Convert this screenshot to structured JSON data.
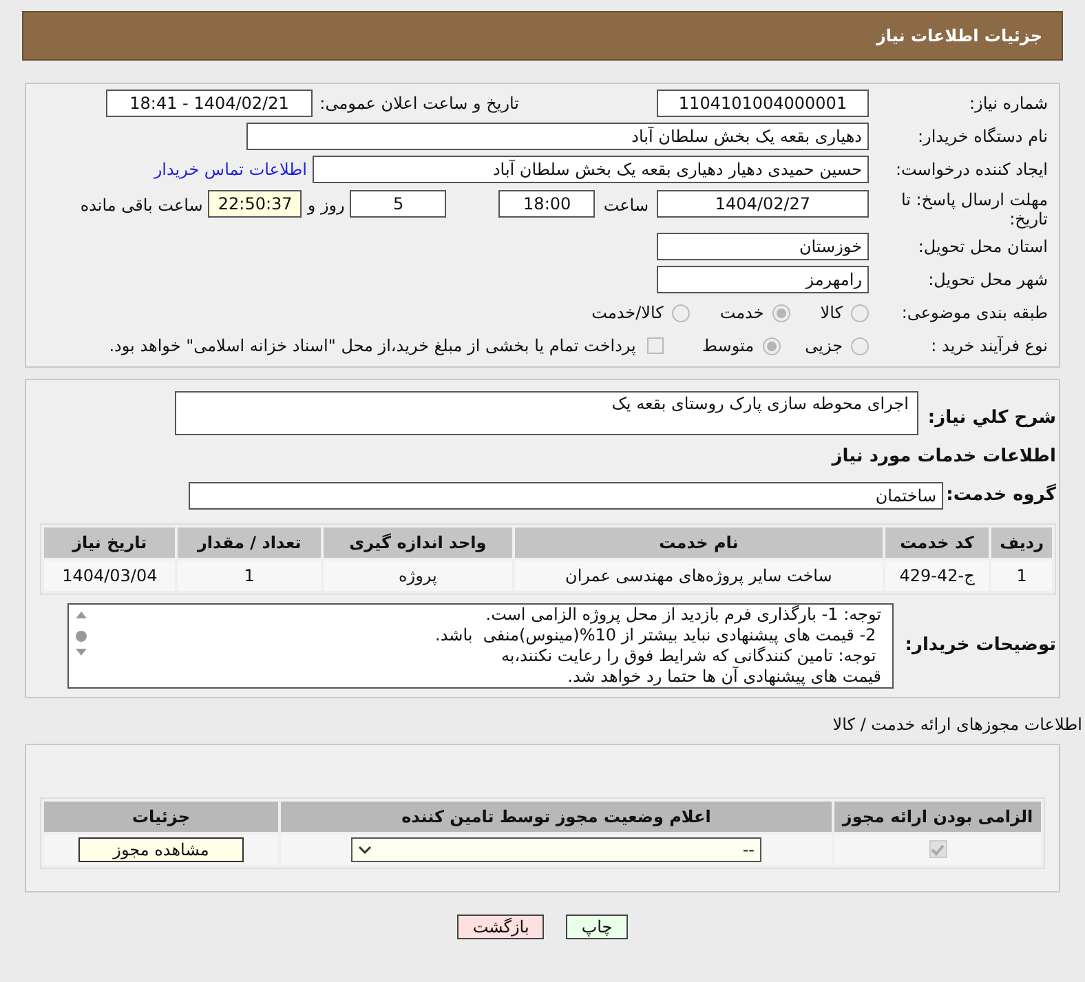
{
  "header": {
    "title": "جزئیات اطلاعات نیاز"
  },
  "need_number": {
    "label": "شماره نیاز:",
    "value": "1104101004000001"
  },
  "announce": {
    "label": "تاریخ و ساعت اعلان عمومی:",
    "value": "1404/02/21 - 18:41"
  },
  "buyer": {
    "label": "نام دستگاه خریدار:",
    "value": "دهیاری بقعه یک بخش سلطان آباد"
  },
  "requester": {
    "label": "ایجاد کننده درخواست:",
    "value": "حسین حمیدی دهیار دهیاری بقعه یک بخش سلطان آباد",
    "link": "اطلاعات تماس خریدار"
  },
  "deadline": {
    "label": "مهلت ارسال پاسخ: تا تاریخ:",
    "date": "1404/02/27",
    "time_label": "ساعت",
    "time": "18:00",
    "days": "5",
    "days_label": "روز و",
    "remaining": "22:50:37",
    "remaining_label": "ساعت باقی مانده"
  },
  "province": {
    "label": "استان محل تحویل:",
    "value": "خوزستان"
  },
  "city": {
    "label": "شهر محل تحویل:",
    "value": "رامهرمز"
  },
  "category": {
    "label": "طبقه بندی موضوعی:",
    "options": [
      {
        "label": "کالا",
        "selected": false
      },
      {
        "label": "خدمت",
        "selected": true
      },
      {
        "label": "کالا/خدمت",
        "selected": false
      }
    ]
  },
  "purchase_type": {
    "label": "نوع فرآیند خرید :",
    "options": [
      {
        "label": "جزیی",
        "selected": false
      },
      {
        "label": "متوسط",
        "selected": true
      }
    ],
    "payment": {
      "checked": false,
      "label": "پرداخت تمام یا بخشی از مبلغ خرید،از محل \"اسناد خزانه اسلامی\" خواهد بود."
    }
  },
  "description": {
    "label": "شرح کلي نیاز:",
    "value": "اجرای محوطه سازی پارک روستای بقعه یک"
  },
  "services_heading": "اطلاعات خدمات مورد نیاز",
  "service_group": {
    "label": "گروه خدمت:",
    "value": "ساختمان"
  },
  "services_table": {
    "columns": [
      "ردیف",
      "کد خدمت",
      "نام خدمت",
      "واحد اندازه گیری",
      "تعداد / مقدار",
      "تاریخ نیاز"
    ],
    "rows": [
      [
        "1",
        "ج-42-429",
        "ساخت سایر پروژه‌های مهندسی عمران",
        "پروژه",
        "1",
        "1404/03/04"
      ]
    ]
  },
  "buyer_notes": {
    "label": "توضیحات خریدار:",
    "lines": [
      "توجه: 1- بارگذاری فرم بازدید از محل پروژه الزامی است.",
      " 2- قیمت های پیشنهادی نباید بیشتر از 10%(مینوس)منفی  باشد.",
      " توجه: تامین کنندگانی که شرایط فوق را رعایت نکنند،به",
      "قیمت های پیشنهادی آن ها حتما رد خواهد شد."
    ]
  },
  "permits_heading": "اطلاعات مجوزهای ارائه خدمت / کالا",
  "permits_table": {
    "columns": [
      "الزامی بودن ارائه مجوز",
      "اعلام وضعیت مجوز توسط تامین کننده",
      "جزئیات"
    ],
    "rows": [
      {
        "required": true,
        "status": "--",
        "action": "مشاهده مجوز"
      }
    ]
  },
  "buttons": [
    {
      "kind": "print",
      "label": "چاپ"
    },
    {
      "kind": "back",
      "label": "بازگشت"
    }
  ]
}
